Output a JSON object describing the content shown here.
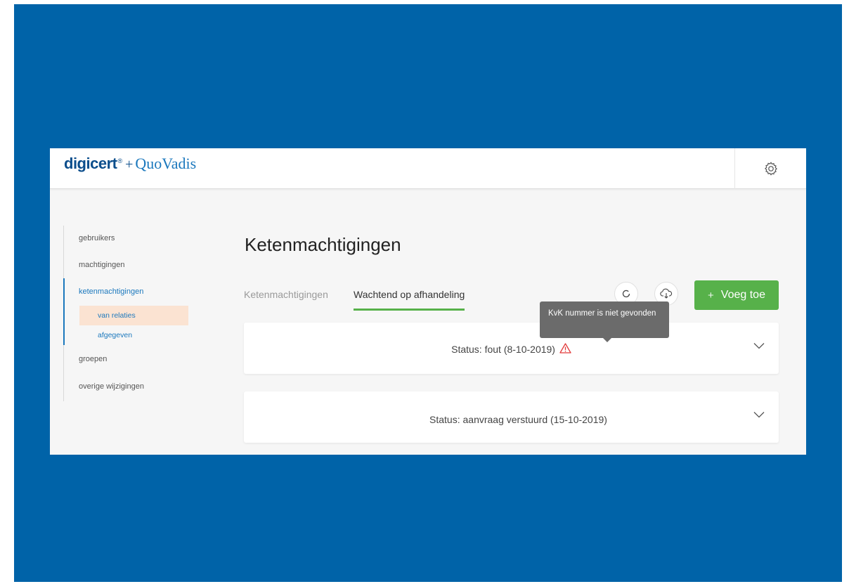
{
  "branding": {
    "logo_primary": "digicert",
    "logo_mark": "®",
    "logo_separator": "+",
    "logo_secondary": "QuoVadis"
  },
  "header": {
    "settings_icon": "gear-icon"
  },
  "sidebar": {
    "items": [
      {
        "label": "gebruikers"
      },
      {
        "label": "machtigingen"
      },
      {
        "label": "ketenmachtigingen",
        "active": true
      },
      {
        "label": "groepen"
      },
      {
        "label": "overige wijzigingen"
      }
    ],
    "sub_items": [
      {
        "label": "van relaties",
        "selected": true
      },
      {
        "label": "afgegeven"
      }
    ]
  },
  "main": {
    "title": "Ketenmachtigingen",
    "tabs": [
      {
        "label": "Ketenmachtigingen",
        "active": false
      },
      {
        "label": "Wachtend op afhandeling",
        "active": true
      }
    ],
    "actions": {
      "refresh_icon": "refresh-icon",
      "download_icon": "cloud-download-icon",
      "add_button_icon": "+",
      "add_button_label": "Voeg toe"
    },
    "cards": [
      {
        "status": "Status: fout (8-10-2019)",
        "warning": true
      },
      {
        "status": "Status: aanvraag verstuurd (15-10-2019)",
        "warning": false
      }
    ],
    "tooltip": {
      "text": "KvK nummer is niet gevonden"
    }
  },
  "colors": {
    "background": "#0063a8",
    "accent_green": "#57b14a",
    "nav_active": "#1b78bd",
    "selected_bg": "#fbe3d2",
    "warning": "#e23b3b"
  }
}
